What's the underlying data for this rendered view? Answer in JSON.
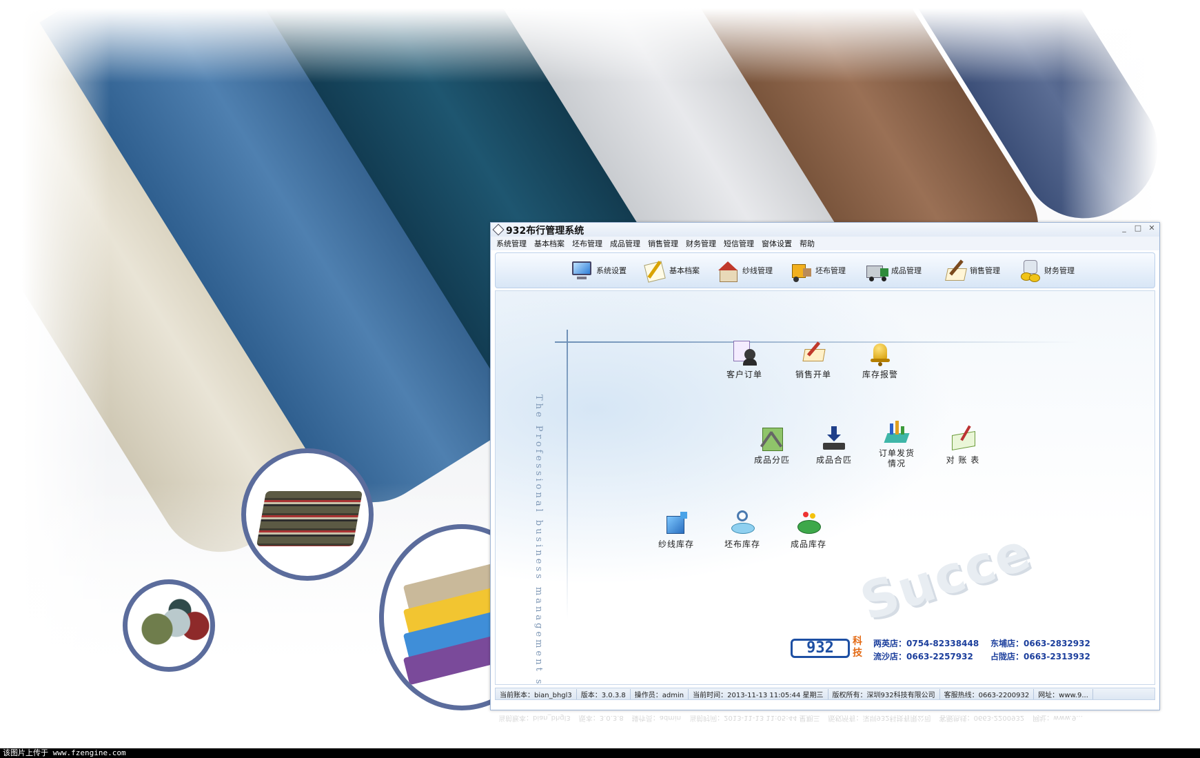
{
  "window": {
    "title": "932布行管理系统",
    "controls": [
      "_",
      "□",
      "✕"
    ]
  },
  "menu": [
    "系统管理",
    "基本档案",
    "坯布管理",
    "成品管理",
    "销售管理",
    "财务管理",
    "短信管理",
    "窗体设置",
    "帮助"
  ],
  "toolbar": [
    {
      "label": "系统设置",
      "icon": "monitor-icon"
    },
    {
      "label": "基本档案",
      "icon": "document-pen-icon"
    },
    {
      "label": "纱线管理",
      "icon": "house-icon"
    },
    {
      "label": "坯布管理",
      "icon": "forklift-icon"
    },
    {
      "label": "成品管理",
      "icon": "truck-icon"
    },
    {
      "label": "销售管理",
      "icon": "pen-paper-icon"
    },
    {
      "label": "财务管理",
      "icon": "coins-icon"
    }
  ],
  "functions": [
    {
      "label": "客户订单",
      "icon": "customer-order-icon"
    },
    {
      "label": "销售开单",
      "icon": "sales-bill-icon"
    },
    {
      "label": "库存报警",
      "icon": "bell-icon"
    },
    {
      "label": "成品分匹",
      "icon": "split-icon"
    },
    {
      "label": "成品合匹",
      "icon": "merge-download-icon"
    },
    {
      "label": "订单发货\n情况",
      "icon": "shipment-chart-icon"
    },
    {
      "label": "对 账 表",
      "icon": "ledger-icon"
    },
    {
      "label": "纱线库存",
      "icon": "yarn-stock-icon"
    },
    {
      "label": "坯布库存",
      "icon": "greige-search-icon"
    },
    {
      "label": "成品库存",
      "icon": "product-stock-icon"
    }
  ],
  "watermark": {
    "vertical_text": "The Professional business management software",
    "success_text": "Succe"
  },
  "logo": {
    "number": "932",
    "suffix": "科技"
  },
  "stores": [
    "两英店：0754-82338448",
    "东埔店：0663-2832932",
    "流沙店：0663-2257932",
    "占陇店：0663-2313932"
  ],
  "status": [
    "当前账本：bian_bhgl3",
    "版本：3.0.3.8",
    "操作员：admin",
    "当前时间：2013-11-13 11:05:44 星期三",
    "版权所有：深圳932科技有限公司",
    "客服热线：0663-2200932",
    "网址：www.9..."
  ],
  "footer_note": "该图片上传于 www.fzengine.com",
  "colors": {
    "accent_blue": "#1d4fa3",
    "logo_orange": "#e36a14",
    "circle_border": "#5b6c9c"
  }
}
